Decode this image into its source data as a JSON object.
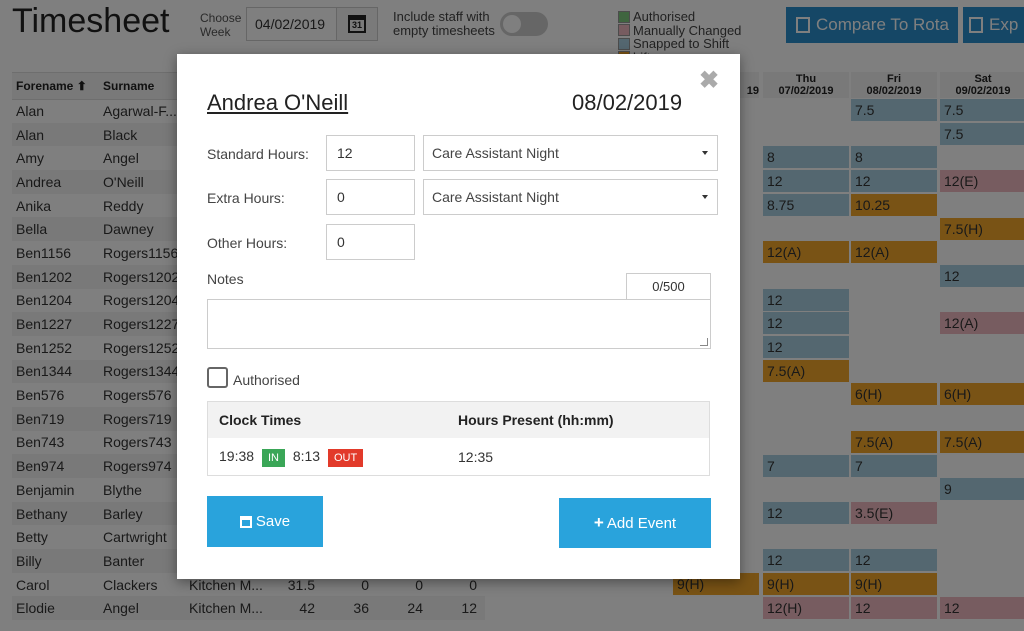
{
  "page": {
    "title": "Timesheet",
    "choose_week_label": "Choose Week",
    "week_date": "04/02/2019",
    "calendar_day": "31",
    "include_staff_label": "Include staff with empty timesheets",
    "compare_button": "Compare To Rota",
    "export_button": "Exp"
  },
  "legend": [
    {
      "label": "Authorised",
      "color": "#7ecb7e"
    },
    {
      "label": "Manually Changed",
      "color": "#efb9c0"
    },
    {
      "label": "Snapped to Shift",
      "color": "#a9cfe0"
    },
    {
      "label": "hift",
      "color": "#f2a62a"
    }
  ],
  "grid": {
    "headers": [
      "Forename",
      "Surname"
    ],
    "rows": [
      {
        "forename": "Alan",
        "surname": "Agarwal-F...",
        "role": "",
        "n1": "",
        "n2": "",
        "n3": "",
        "n4": ""
      },
      {
        "forename": "Alan",
        "surname": "Black",
        "role": "",
        "n1": "",
        "n2": "",
        "n3": "",
        "n4": ""
      },
      {
        "forename": "Amy",
        "surname": "Angel",
        "role": "",
        "n1": "",
        "n2": "",
        "n3": "",
        "n4": ""
      },
      {
        "forename": "Andrea",
        "surname": "O'Neill",
        "role": "",
        "n1": "",
        "n2": "",
        "n3": "",
        "n4": ""
      },
      {
        "forename": "Anika",
        "surname": "Reddy",
        "role": "",
        "n1": "",
        "n2": "",
        "n3": "",
        "n4": ""
      },
      {
        "forename": "Bella",
        "surname": "Dawney",
        "role": "",
        "n1": "",
        "n2": "",
        "n3": "",
        "n4": ""
      },
      {
        "forename": "Ben1156",
        "surname": "Rogers1156",
        "role": "",
        "n1": "",
        "n2": "",
        "n3": "",
        "n4": ""
      },
      {
        "forename": "Ben1202",
        "surname": "Rogers1202",
        "role": "",
        "n1": "",
        "n2": "",
        "n3": "",
        "n4": ""
      },
      {
        "forename": "Ben1204",
        "surname": "Rogers1204",
        "role": "",
        "n1": "",
        "n2": "",
        "n3": "",
        "n4": ""
      },
      {
        "forename": "Ben1227",
        "surname": "Rogers1227",
        "role": "",
        "n1": "",
        "n2": "",
        "n3": "",
        "n4": ""
      },
      {
        "forename": "Ben1252",
        "surname": "Rogers1252",
        "role": "",
        "n1": "",
        "n2": "",
        "n3": "",
        "n4": ""
      },
      {
        "forename": "Ben1344",
        "surname": "Rogers1344",
        "role": "",
        "n1": "",
        "n2": "",
        "n3": "",
        "n4": ""
      },
      {
        "forename": "Ben576",
        "surname": "Rogers576",
        "role": "",
        "n1": "",
        "n2": "",
        "n3": "",
        "n4": ""
      },
      {
        "forename": "Ben719",
        "surname": "Rogers719",
        "role": "",
        "n1": "",
        "n2": "",
        "n3": "",
        "n4": ""
      },
      {
        "forename": "Ben743",
        "surname": "Rogers743",
        "role": "",
        "n1": "",
        "n2": "",
        "n3": "",
        "n4": ""
      },
      {
        "forename": "Ben974",
        "surname": "Rogers974",
        "role": "",
        "n1": "",
        "n2": "",
        "n3": "",
        "n4": ""
      },
      {
        "forename": "Benjamin",
        "surname": "Blythe",
        "role": "",
        "n1": "",
        "n2": "",
        "n3": "",
        "n4": ""
      },
      {
        "forename": "Bethany",
        "surname": "Barley",
        "role": "",
        "n1": "",
        "n2": "",
        "n3": "",
        "n4": ""
      },
      {
        "forename": "Betty",
        "surname": "Cartwright",
        "role": "",
        "n1": "",
        "n2": "",
        "n3": "",
        "n4": ""
      },
      {
        "forename": "Billy",
        "surname": "Banter",
        "role": "",
        "n1": "",
        "n2": "",
        "n3": "",
        "n4": ""
      },
      {
        "forename": "Carol",
        "surname": "Clackers",
        "role": "Kitchen M...",
        "n1": "31.5",
        "n2": "0",
        "n3": "0",
        "n4": "0"
      },
      {
        "forename": "Elodie",
        "surname": "Angel",
        "role": "Kitchen M...",
        "n1": "42",
        "n2": "36",
        "n3": "24",
        "n4": "12"
      }
    ]
  },
  "days": [
    {
      "name": "Thu",
      "date": "07/02/2019"
    },
    {
      "name": "Fri",
      "date": "08/02/2019"
    },
    {
      "name": "Sat",
      "date": "09/02/2019"
    }
  ],
  "day_partial": "19",
  "cells": [
    {
      "row": 0,
      "col": 1,
      "text": "7.5",
      "color": "blue"
    },
    {
      "row": 0,
      "col": 2,
      "text": "7.5",
      "color": "blue"
    },
    {
      "row": 1,
      "col": 2,
      "text": "7.5",
      "color": "blue"
    },
    {
      "row": 2,
      "col": 0,
      "text": "8",
      "color": "blue"
    },
    {
      "row": 2,
      "col": 1,
      "text": "8",
      "color": "blue"
    },
    {
      "row": 3,
      "col": 0,
      "text": "12",
      "color": "blue"
    },
    {
      "row": 3,
      "col": 1,
      "text": "12",
      "color": "blue"
    },
    {
      "row": 3,
      "col": 2,
      "text": "12(E)",
      "color": "pink"
    },
    {
      "row": 4,
      "col": 0,
      "text": "8.75",
      "color": "blue"
    },
    {
      "row": 4,
      "col": 1,
      "text": "10.25",
      "color": "orange"
    },
    {
      "row": 5,
      "col": 2,
      "text": "7.5(H)",
      "color": "orange"
    },
    {
      "row": 6,
      "col": 0,
      "text": "12(A)",
      "color": "orange"
    },
    {
      "row": 6,
      "col": 1,
      "text": "12(A)",
      "color": "orange"
    },
    {
      "row": 7,
      "col": 2,
      "text": "12",
      "color": "blue"
    },
    {
      "row": 8,
      "col": 0,
      "text": "12",
      "color": "blue"
    },
    {
      "row": 9,
      "col": 0,
      "text": "12",
      "color": "blue"
    },
    {
      "row": 9,
      "col": 2,
      "text": "12(A)",
      "color": "pink"
    },
    {
      "row": 10,
      "col": 0,
      "text": "12",
      "color": "blue"
    },
    {
      "row": 11,
      "col": 0,
      "text": "7.5(A)",
      "color": "orange"
    },
    {
      "row": 12,
      "col": 1,
      "text": "6(H)",
      "color": "orange"
    },
    {
      "row": 12,
      "col": 2,
      "text": "6(H)",
      "color": "orange"
    },
    {
      "row": 14,
      "col": 1,
      "text": "7.5(A)",
      "color": "orange"
    },
    {
      "row": 14,
      "col": 2,
      "text": "7.5(A)",
      "color": "orange"
    },
    {
      "row": 15,
      "col": 0,
      "text": "7",
      "color": "blue"
    },
    {
      "row": 15,
      "col": 1,
      "text": "7",
      "color": "blue"
    },
    {
      "row": 16,
      "col": 2,
      "text": "9",
      "color": "blue"
    },
    {
      "row": 17,
      "col": 0,
      "text": "12",
      "color": "blue"
    },
    {
      "row": 17,
      "col": 1,
      "text": "3.5(E)",
      "color": "pink"
    },
    {
      "row": 19,
      "col": 0,
      "text": "12",
      "color": "blue"
    },
    {
      "row": 19,
      "col": 1,
      "text": "12",
      "color": "blue"
    },
    {
      "row": 20,
      "col": -1,
      "text": "9(H)",
      "color": "orange"
    },
    {
      "row": 20,
      "col": 0,
      "text": "9(H)",
      "color": "orange"
    },
    {
      "row": 20,
      "col": 1,
      "text": "9(H)",
      "color": "orange"
    },
    {
      "row": 21,
      "col": 0,
      "text": "12(H)",
      "color": "pink"
    },
    {
      "row": 21,
      "col": 1,
      "text": "12",
      "color": "pink"
    },
    {
      "row": 21,
      "col": 2,
      "text": "12",
      "color": "pink"
    }
  ],
  "modal": {
    "staff_name": "Andrea O'Neill",
    "date": "08/02/2019",
    "standard_hours_label": "Standard Hours:",
    "standard_hours_value": "12",
    "standard_role": "Care Assistant Night",
    "extra_hours_label": "Extra Hours:",
    "extra_hours_value": "0",
    "extra_role": "Care Assistant Night",
    "other_hours_label": "Other Hours:",
    "other_hours_value": "0",
    "notes_label": "Notes",
    "notes_count": "0/500",
    "authorised_label": "Authorised",
    "authorised": false,
    "clock_times_header": "Clock Times",
    "hours_present_header": "Hours Present (hh:mm)",
    "clock_in_time": "19:38",
    "in_tag": "IN",
    "clock_out_time": "8:13",
    "out_tag": "OUT",
    "hours_present": "12:35",
    "save_button": "Save",
    "add_event_button": "Add Event"
  }
}
